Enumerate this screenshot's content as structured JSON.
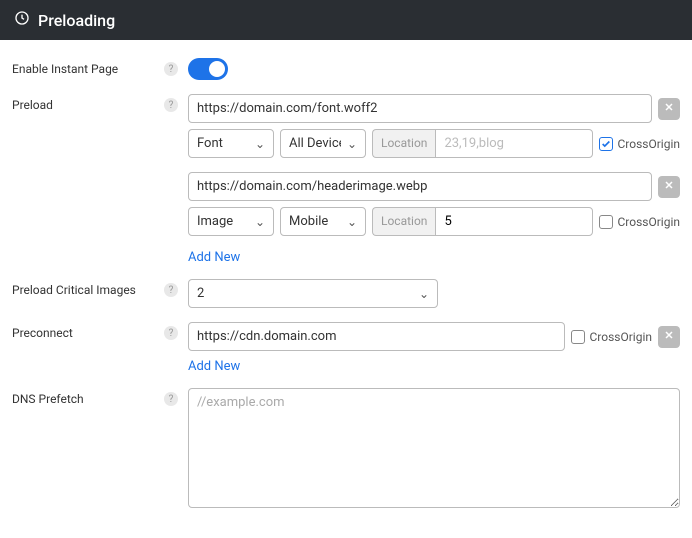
{
  "header": {
    "title": "Preloading"
  },
  "instantPage": {
    "label": "Enable Instant Page",
    "enabled": true
  },
  "preload": {
    "label": "Preload",
    "addNew": "Add New",
    "locationLabel": "Location",
    "crossOriginLabel": "CrossOrigin",
    "rows": [
      {
        "url": "https://domain.com/font.woff2",
        "type": "Font",
        "device": "All Devices",
        "locationPlaceholder": "23,19,blog",
        "locationValue": "",
        "crossOrigin": true
      },
      {
        "url": "https://domain.com/headerimage.webp",
        "type": "Image",
        "device": "Mobile",
        "locationPlaceholder": "",
        "locationValue": "5",
        "crossOrigin": false
      }
    ]
  },
  "critical": {
    "label": "Preload Critical Images",
    "value": "2"
  },
  "preconnect": {
    "label": "Preconnect",
    "addNew": "Add New",
    "crossOriginLabel": "CrossOrigin",
    "rows": [
      {
        "url": "https://cdn.domain.com",
        "crossOrigin": false
      }
    ]
  },
  "dnsPrefetch": {
    "label": "DNS Prefetch",
    "placeholder": "//example.com",
    "value": ""
  }
}
